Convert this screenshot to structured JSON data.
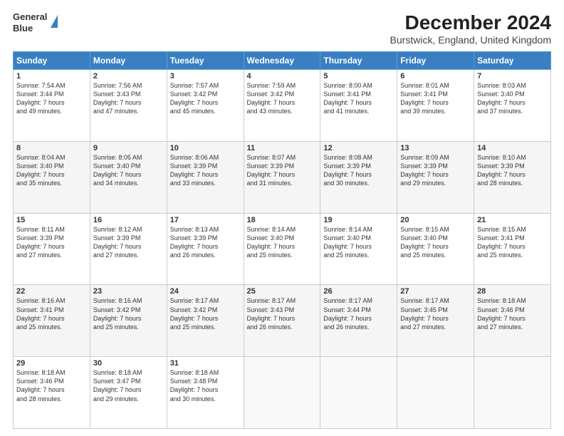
{
  "logo": {
    "line1": "General",
    "line2": "Blue"
  },
  "title": "December 2024",
  "subtitle": "Burstwick, England, United Kingdom",
  "days_of_week": [
    "Sunday",
    "Monday",
    "Tuesday",
    "Wednesday",
    "Thursday",
    "Friday",
    "Saturday"
  ],
  "weeks": [
    [
      {
        "day": 1,
        "info": "Sunrise: 7:54 AM\nSunset: 3:44 PM\nDaylight: 7 hours\nand 49 minutes."
      },
      {
        "day": 2,
        "info": "Sunrise: 7:56 AM\nSunset: 3:43 PM\nDaylight: 7 hours\nand 47 minutes."
      },
      {
        "day": 3,
        "info": "Sunrise: 7:57 AM\nSunset: 3:42 PM\nDaylight: 7 hours\nand 45 minutes."
      },
      {
        "day": 4,
        "info": "Sunrise: 7:59 AM\nSunset: 3:42 PM\nDaylight: 7 hours\nand 43 minutes."
      },
      {
        "day": 5,
        "info": "Sunrise: 8:00 AM\nSunset: 3:41 PM\nDaylight: 7 hours\nand 41 minutes."
      },
      {
        "day": 6,
        "info": "Sunrise: 8:01 AM\nSunset: 3:41 PM\nDaylight: 7 hours\nand 39 minutes."
      },
      {
        "day": 7,
        "info": "Sunrise: 8:03 AM\nSunset: 3:40 PM\nDaylight: 7 hours\nand 37 minutes."
      }
    ],
    [
      {
        "day": 8,
        "info": "Sunrise: 8:04 AM\nSunset: 3:40 PM\nDaylight: 7 hours\nand 35 minutes."
      },
      {
        "day": 9,
        "info": "Sunrise: 8:05 AM\nSunset: 3:40 PM\nDaylight: 7 hours\nand 34 minutes."
      },
      {
        "day": 10,
        "info": "Sunrise: 8:06 AM\nSunset: 3:39 PM\nDaylight: 7 hours\nand 33 minutes."
      },
      {
        "day": 11,
        "info": "Sunrise: 8:07 AM\nSunset: 3:39 PM\nDaylight: 7 hours\nand 31 minutes."
      },
      {
        "day": 12,
        "info": "Sunrise: 8:08 AM\nSunset: 3:39 PM\nDaylight: 7 hours\nand 30 minutes."
      },
      {
        "day": 13,
        "info": "Sunrise: 8:09 AM\nSunset: 3:39 PM\nDaylight: 7 hours\nand 29 minutes."
      },
      {
        "day": 14,
        "info": "Sunrise: 8:10 AM\nSunset: 3:39 PM\nDaylight: 7 hours\nand 28 minutes."
      }
    ],
    [
      {
        "day": 15,
        "info": "Sunrise: 8:11 AM\nSunset: 3:39 PM\nDaylight: 7 hours\nand 27 minutes."
      },
      {
        "day": 16,
        "info": "Sunrise: 8:12 AM\nSunset: 3:39 PM\nDaylight: 7 hours\nand 27 minutes."
      },
      {
        "day": 17,
        "info": "Sunrise: 8:13 AM\nSunset: 3:39 PM\nDaylight: 7 hours\nand 26 minutes."
      },
      {
        "day": 18,
        "info": "Sunrise: 8:14 AM\nSunset: 3:40 PM\nDaylight: 7 hours\nand 25 minutes."
      },
      {
        "day": 19,
        "info": "Sunrise: 8:14 AM\nSunset: 3:40 PM\nDaylight: 7 hours\nand 25 minutes."
      },
      {
        "day": 20,
        "info": "Sunrise: 8:15 AM\nSunset: 3:40 PM\nDaylight: 7 hours\nand 25 minutes."
      },
      {
        "day": 21,
        "info": "Sunrise: 8:15 AM\nSunset: 3:41 PM\nDaylight: 7 hours\nand 25 minutes."
      }
    ],
    [
      {
        "day": 22,
        "info": "Sunrise: 8:16 AM\nSunset: 3:41 PM\nDaylight: 7 hours\nand 25 minutes."
      },
      {
        "day": 23,
        "info": "Sunrise: 8:16 AM\nSunset: 3:42 PM\nDaylight: 7 hours\nand 25 minutes."
      },
      {
        "day": 24,
        "info": "Sunrise: 8:17 AM\nSunset: 3:42 PM\nDaylight: 7 hours\nand 25 minutes."
      },
      {
        "day": 25,
        "info": "Sunrise: 8:17 AM\nSunset: 3:43 PM\nDaylight: 7 hours\nand 26 minutes."
      },
      {
        "day": 26,
        "info": "Sunrise: 8:17 AM\nSunset: 3:44 PM\nDaylight: 7 hours\nand 26 minutes."
      },
      {
        "day": 27,
        "info": "Sunrise: 8:17 AM\nSunset: 3:45 PM\nDaylight: 7 hours\nand 27 minutes."
      },
      {
        "day": 28,
        "info": "Sunrise: 8:18 AM\nSunset: 3:46 PM\nDaylight: 7 hours\nand 27 minutes."
      }
    ],
    [
      {
        "day": 29,
        "info": "Sunrise: 8:18 AM\nSunset: 3:46 PM\nDaylight: 7 hours\nand 28 minutes."
      },
      {
        "day": 30,
        "info": "Sunrise: 8:18 AM\nSunset: 3:47 PM\nDaylight: 7 hours\nand 29 minutes."
      },
      {
        "day": 31,
        "info": "Sunrise: 8:18 AM\nSunset: 3:48 PM\nDaylight: 7 hours\nand 30 minutes."
      },
      null,
      null,
      null,
      null
    ]
  ]
}
